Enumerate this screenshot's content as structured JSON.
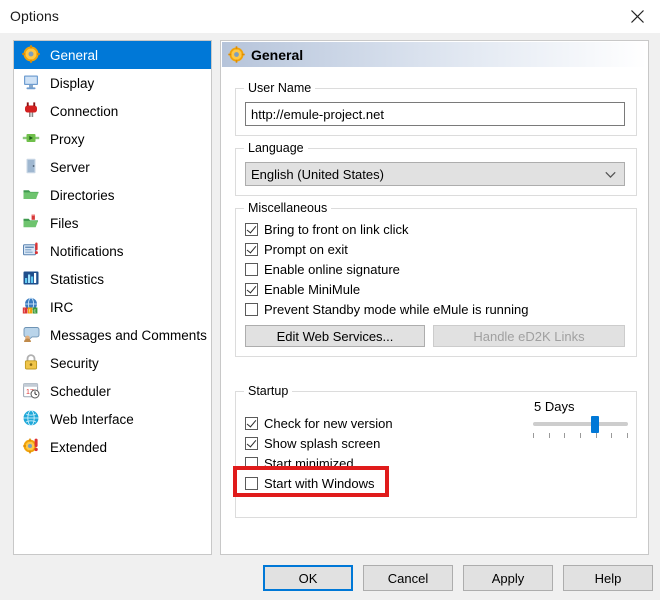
{
  "window": {
    "title": "Options",
    "close_icon": "close-icon"
  },
  "sidebar": {
    "items": [
      {
        "label": "General",
        "icon": "gear-icon",
        "selected": true
      },
      {
        "label": "Display",
        "icon": "monitor-icon",
        "selected": false
      },
      {
        "label": "Connection",
        "icon": "plug-icon",
        "selected": false
      },
      {
        "label": "Proxy",
        "icon": "proxy-icon",
        "selected": false
      },
      {
        "label": "Server",
        "icon": "server-icon",
        "selected": false
      },
      {
        "label": "Directories",
        "icon": "folder-icon",
        "selected": false
      },
      {
        "label": "Files",
        "icon": "files-icon",
        "selected": false
      },
      {
        "label": "Notifications",
        "icon": "notification-icon",
        "selected": false
      },
      {
        "label": "Statistics",
        "icon": "statistics-icon",
        "selected": false
      },
      {
        "label": "IRC",
        "icon": "irc-icon",
        "selected": false
      },
      {
        "label": "Messages and Comments",
        "icon": "messages-icon",
        "selected": false
      },
      {
        "label": "Security",
        "icon": "lock-icon",
        "selected": false
      },
      {
        "label": "Scheduler",
        "icon": "calendar-icon",
        "selected": false
      },
      {
        "label": "Web Interface",
        "icon": "globe-icon",
        "selected": false
      },
      {
        "label": "Extended",
        "icon": "extended-icon",
        "selected": false
      }
    ]
  },
  "panel": {
    "header_title": "General",
    "header_icon": "gear-icon",
    "user_name": {
      "legend": "User Name",
      "value": "http://emule-project.net"
    },
    "language": {
      "legend": "Language",
      "selected": "English (United States)",
      "arrow_icon": "chevron-down-icon"
    },
    "miscellaneous": {
      "legend": "Miscellaneous",
      "checkboxes": [
        {
          "label": "Bring to front on link click",
          "checked": true
        },
        {
          "label": "Prompt on exit",
          "checked": true
        },
        {
          "label": "Enable online signature",
          "checked": false
        },
        {
          "label": "Enable MiniMule",
          "checked": true
        },
        {
          "label": "Prevent Standby mode while eMule is running",
          "checked": false
        }
      ],
      "edit_web_services_label": "Edit Web Services...",
      "handle_ed2k_label": "Handle eD2K Links",
      "handle_ed2k_disabled": true
    },
    "startup": {
      "legend": "Startup",
      "checkboxes": [
        {
          "label": "Check for new version",
          "checked": true
        },
        {
          "label": "Show splash screen",
          "checked": true
        },
        {
          "label": "Start minimized",
          "checked": false
        },
        {
          "label": "Start with Windows",
          "checked": false
        }
      ],
      "slider": {
        "label": "5 Days",
        "value": 5,
        "min": 1,
        "max": 7,
        "ticks": 7
      }
    }
  },
  "footer": {
    "buttons": [
      {
        "label": "OK",
        "default": true,
        "disabled": false
      },
      {
        "label": "Cancel",
        "default": false,
        "disabled": false
      },
      {
        "label": "Apply",
        "default": false,
        "disabled": false
      },
      {
        "label": "Help",
        "default": false,
        "disabled": false
      }
    ]
  },
  "annotation": {
    "highlight_color": "#e01b1b",
    "highlights": "start-with-windows"
  }
}
